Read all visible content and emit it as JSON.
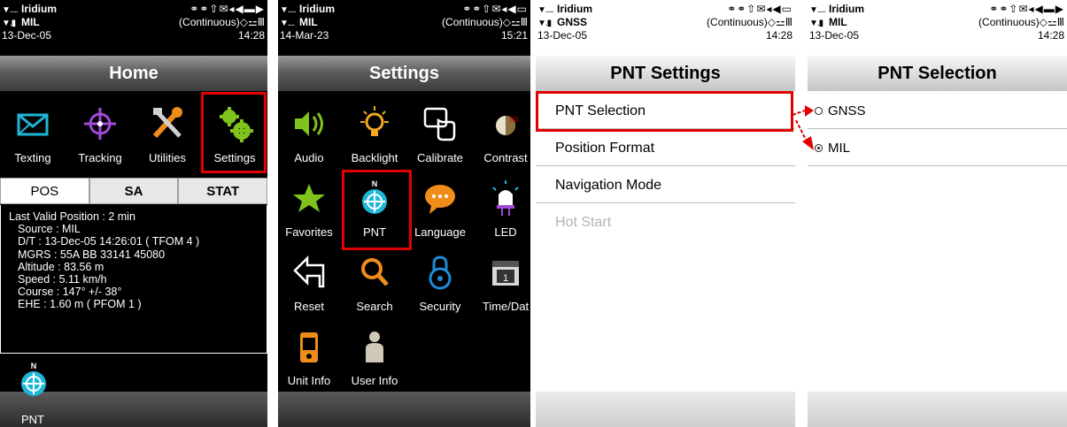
{
  "panels": [
    {
      "status": {
        "network": "Iridium",
        "mode": "MIL",
        "date": "13-Dec-05",
        "continuous": "(Continuous)",
        "time": "14:28"
      },
      "title": "Home",
      "icons": [
        {
          "label": "Texting",
          "icon": "envelope-icon"
        },
        {
          "label": "Tracking",
          "icon": "crosshair-icon"
        },
        {
          "label": "Utilities",
          "icon": "tools-icon"
        },
        {
          "label": "Settings",
          "icon": "gears-icon"
        }
      ],
      "tabs": [
        "POS",
        "SA",
        "STAT"
      ],
      "info": {
        "header": "Last Valid Position :  2 min",
        "lines": [
          "Source :  MIL",
          "D/T :  13-Dec-05 14:26:01  ( TFOM 4 )",
          "MGRS :  55A BB 33141 45080",
          "Altitude :  83.56 m",
          "Speed :  5.11 km/h",
          "Course :  147° +/- 38°",
          "EHE :  1.60 m  ( PFOM 1 )"
        ]
      },
      "bottom_label": "PNT"
    },
    {
      "status": {
        "network": "Iridium",
        "mode": "MIL",
        "date": "14-Mar-23",
        "continuous": "(Continuous)",
        "time": "15:21"
      },
      "title": "Settings",
      "icons": [
        {
          "label": "Audio",
          "icon": "speaker-icon"
        },
        {
          "label": "Backlight",
          "icon": "bulb-icon"
        },
        {
          "label": "Calibrate",
          "icon": "touch-icon"
        },
        {
          "label": "Contrast",
          "icon": "contrast-icon"
        },
        {
          "label": "Favorites",
          "icon": "star-icon"
        },
        {
          "label": "PNT",
          "icon": "pnt-icon"
        },
        {
          "label": "Language",
          "icon": "speech-bubble-icon"
        },
        {
          "label": "LED",
          "icon": "led-icon"
        },
        {
          "label": "Reset",
          "icon": "back-arrow-icon"
        },
        {
          "label": "Search",
          "icon": "magnifier-icon"
        },
        {
          "label": "Security",
          "icon": "lock-icon"
        },
        {
          "label": "Time/Dat",
          "icon": "calendar-icon"
        },
        {
          "label": "Unit Info",
          "icon": "device-icon"
        },
        {
          "label": "User Info",
          "icon": "user-icon"
        }
      ]
    },
    {
      "status": {
        "network": "Iridium",
        "mode": "GNSS",
        "date": "13-Dec-05",
        "continuous": "(Continuous)",
        "time": "14:28"
      },
      "title": "PNT Settings",
      "items": [
        {
          "label": "PNT Selection",
          "enabled": true
        },
        {
          "label": "Position Format",
          "enabled": true
        },
        {
          "label": "Navigation Mode",
          "enabled": true
        },
        {
          "label": "Hot Start",
          "enabled": false
        }
      ]
    },
    {
      "status": {
        "network": "Iridium",
        "mode": "MIL",
        "date": "13-Dec-05",
        "continuous": "(Continuous)",
        "time": "14:28"
      },
      "title": "PNT Selection",
      "options": [
        {
          "label": "GNSS",
          "selected": false
        },
        {
          "label": "MIL",
          "selected": true
        }
      ]
    }
  ],
  "colors": {
    "highlight": "#e30000",
    "accent_cyan": "#1fb6d8",
    "accent_purple": "#a24ad8",
    "accent_green": "#7fc31c"
  }
}
